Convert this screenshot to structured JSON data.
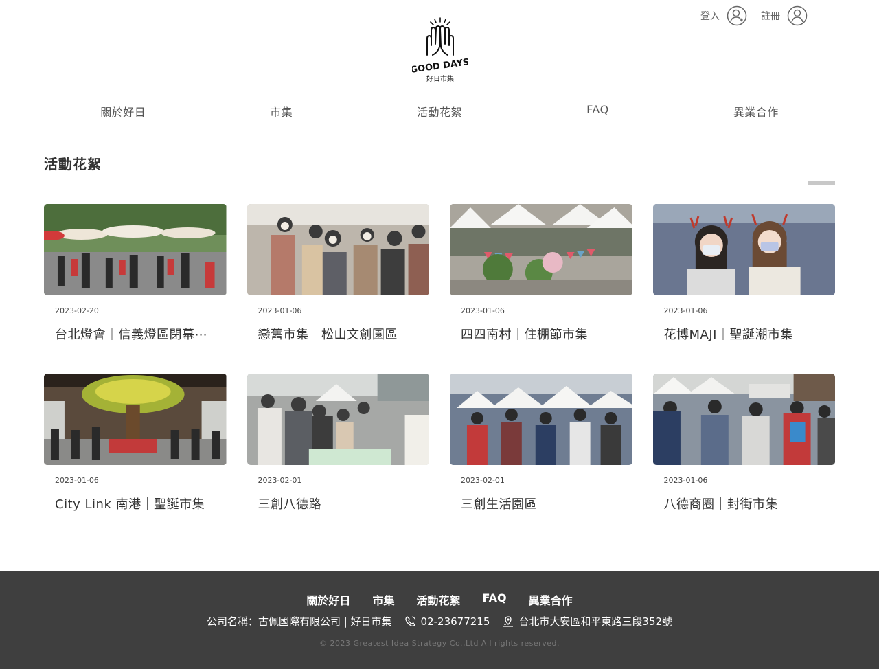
{
  "brand": {
    "logo_text": "GOOD DAYS",
    "logo_subtext": "好日市集"
  },
  "auth": {
    "login_label": "登入",
    "register_label": "註冊"
  },
  "nav": {
    "items": [
      {
        "label": "關於好日"
      },
      {
        "label": "市集"
      },
      {
        "label": "活動花絮"
      },
      {
        "label": "FAQ"
      },
      {
        "label": "異業合作"
      }
    ]
  },
  "section": {
    "title": "活動花絮"
  },
  "cards": [
    {
      "date": "2023-02-20",
      "title": "台北燈會｜信義燈區閉幕⋯",
      "theme": "#7a9a6a"
    },
    {
      "date": "2023-01-06",
      "title": "戀舊市集｜松山文創園區",
      "theme": "#8b7a6e"
    },
    {
      "date": "2023-01-06",
      "title": "四四南村｜住棚節市集",
      "theme": "#9aa88c"
    },
    {
      "date": "2023-01-06",
      "title": "花博MAJI｜聖誕潮市集",
      "theme": "#6f7f95"
    },
    {
      "date": "2023-01-06",
      "title": "City Link 南港｜聖誕市集",
      "theme": "#6b5a48"
    },
    {
      "date": "2023-02-01",
      "title": "三創八德路",
      "theme": "#8f9aa0"
    },
    {
      "date": "2023-02-01",
      "title": "三創生活園區",
      "theme": "#8a96a6"
    },
    {
      "date": "2023-01-06",
      "title": "八德商圈｜封街市集",
      "theme": "#7f8c9c"
    }
  ],
  "footer": {
    "nav": [
      "關於好日",
      "市集",
      "活動花絮",
      "FAQ",
      "異業合作"
    ],
    "company": "公司名稱：古佩國際有限公司 | 好日市集",
    "phone": "02-23677215",
    "address": "台北市大安區和平東路三段352號",
    "copyright": "© 2023 Greatest Idea Strategy Co.,Ltd All rights reserved."
  },
  "colors": {
    "footer_bg": "#3f3f3f",
    "divider": "#cfcfcf",
    "text": "#333333"
  }
}
